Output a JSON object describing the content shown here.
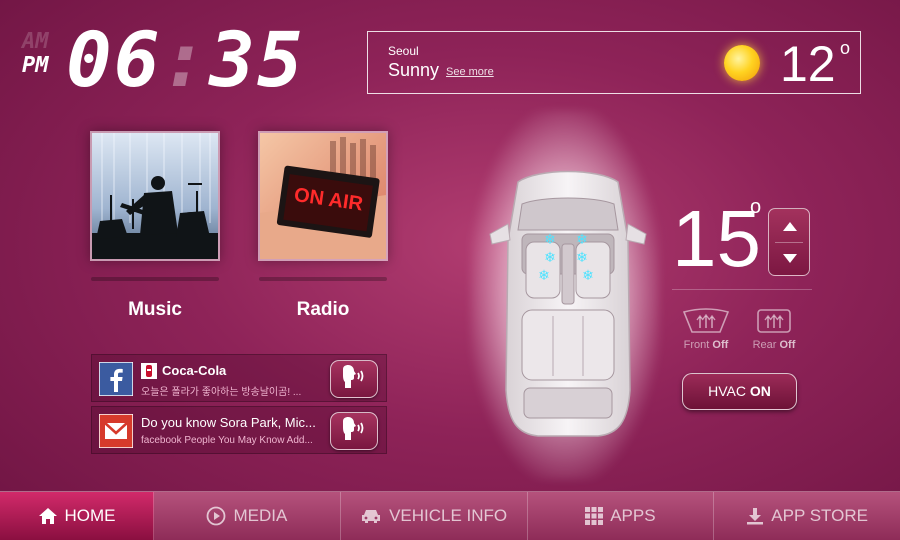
{
  "clock": {
    "am": "AM",
    "pm": "PM",
    "hours": "06",
    "colon": ":",
    "minutes": "35"
  },
  "weather": {
    "city": "Seoul",
    "condition": "Sunny",
    "see_more": "See more",
    "temperature": "12",
    "degree": "o",
    "icon": "sun-icon"
  },
  "media_tiles": [
    {
      "label": "Music",
      "icon": "concert-photo"
    },
    {
      "label": "Radio",
      "icon": "on-air-photo",
      "sign_text": "ON AIR"
    }
  ],
  "notifications": [
    {
      "source_icon": "facebook-icon",
      "avatar_icon": "coca-cola-avatar",
      "title": "Coca-Cola",
      "subtitle": "오늘은 폴라가 좋아하는 방송날이곰! ...",
      "action_icon": "speak-icon"
    },
    {
      "source_icon": "gmail-icon",
      "title": "Do you know Sora Park, Mic...",
      "subtitle": "facebook People You May Know Add...",
      "action_icon": "speak-icon"
    }
  ],
  "climate": {
    "temperature": "15",
    "degree": "o",
    "front_label": "Front",
    "front_state": "Off",
    "rear_label": "Rear",
    "rear_state": "Off",
    "hvac_label": "HVAC",
    "hvac_state": "ON"
  },
  "nav": [
    {
      "label": "HOME",
      "icon": "home-icon",
      "active": true
    },
    {
      "label": "MEDIA",
      "icon": "play-circle-icon",
      "active": false
    },
    {
      "label": "VEHICLE INFO",
      "icon": "car-icon",
      "active": false
    },
    {
      "label": "APPS",
      "icon": "grid-icon",
      "active": false
    },
    {
      "label": "APP STORE",
      "icon": "download-icon",
      "active": false
    }
  ],
  "colors": {
    "accent": "#c2246a",
    "background": "#8e2358",
    "snow": "#4fe3ff",
    "sun": "#ffd321"
  }
}
